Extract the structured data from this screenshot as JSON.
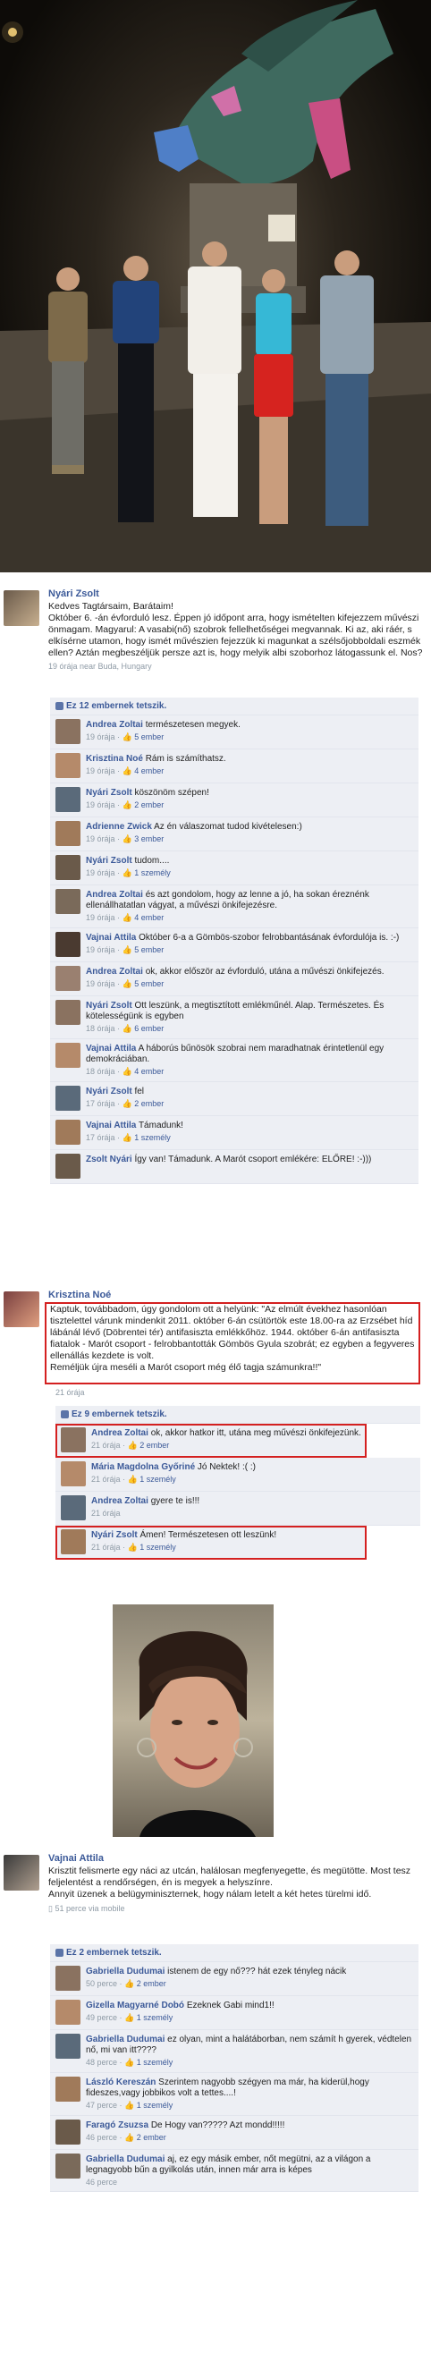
{
  "post1": {
    "author": "Nyári Zsolt",
    "text": "Kedves Tagtársaim, Barátaim!\nOktóber 6. -án évforduló lesz. Éppen jó időpont arra, hogy ismételten kifejezzem művészi önmagam. Magyarul: A vasabi(nő) szobrok fellelhetőségei megvannak. Ki az, aki ráér, s elkísérne utamon, hogy ismét művészien fejezzük ki magunkat a szélsőjobboldali eszmék ellen? Aztán megbeszéljük persze azt is, hogy melyik albi szoborhoz látogassunk el. Nos?",
    "meta": "19 órája near Buda, Hungary",
    "likes": "Ez 12 embernek tetszik.",
    "comments": [
      {
        "author": "Andrea Zoltai",
        "text": "természetesen megyek.",
        "time": "19 órája",
        "likes": "5 ember"
      },
      {
        "author": "Krisztina Noé",
        "text": "Rám is számíthatsz.",
        "time": "19 órája",
        "likes": "4 ember"
      },
      {
        "author": "Nyári Zsolt",
        "text": "köszönöm szépen!",
        "time": "19 órája",
        "likes": "2 ember"
      },
      {
        "author": "Adrienne Zwick",
        "text": "Az én válaszomat tudod kivételesen:)",
        "time": "19 órája",
        "likes": "3 ember"
      },
      {
        "author": "Nyári Zsolt",
        "text": "tudom....",
        "time": "19 órája",
        "likes": "1 személy"
      },
      {
        "author": "Andrea Zoltai",
        "text": "és azt gondolom, hogy az lenne a jó, ha sokan éreznénk ellenállhatatlan vágyat, a művészi önkifejezésre.",
        "time": "19 órája",
        "likes": "4 ember"
      },
      {
        "author": "Vajnai Attila",
        "text": "Október 6-a a Gömbös-szobor felrobbantásának évfordulója is. :-)",
        "time": "19 órája",
        "likes": "5 ember"
      },
      {
        "author": "Andrea Zoltai",
        "text": "ok, akkor először az évforduló, utána a művészi önkifejezés.",
        "time": "19 órája",
        "likes": "5 ember"
      },
      {
        "author": "Nyári Zsolt",
        "text": "Ott leszünk, a megtisztított emlékműnél. Alap. Természetes. És kötelességünk is egyben",
        "time": "18 órája",
        "likes": "6 ember"
      },
      {
        "author": "Vajnai Attila",
        "text": "A háborús bűnösök szobrai nem maradhatnak érintetlenül egy demokráciában.",
        "time": "18 órája",
        "likes": "4 ember"
      },
      {
        "author": "Nyári Zsolt",
        "text": "fel",
        "time": "17 órája",
        "likes": "2 ember"
      },
      {
        "author": "Vajnai Attila",
        "text": "Támadunk!",
        "time": "17 órája",
        "likes": "1 személy"
      },
      {
        "author": "Zsolt Nyári",
        "text": "Így van! Támadunk. A Marót csoport emlékére: ELŐRE! :-)))",
        "time": "",
        "likes": ""
      }
    ]
  },
  "post2": {
    "author": "Krisztina Noé",
    "text": "Kaptuk, továbbadom, úgy gondolom ott a helyünk: \"Az elmúlt évekhez hasonlóan tisztelettel várunk mindenkit 2011. október 6-án csütörtök este 18.00-ra az Erzsébet híd lábánál lévő (Döbrentei tér) antifasiszta emlékkőhöz. 1944. október 6-án antifasiszta fiatalok - Marót csoport - felrobbantották Gömbös Gyula szobrát; ez egyben a fegyveres ellenállás kezdete is volt.\nReméljük újra meséli a Marót csoport még élő tagja számunkra!!\"",
    "meta": "21 órája",
    "likes": "Ez 9 embernek tetszik.",
    "comments": [
      {
        "author": "Andrea Zoltai",
        "text": "ok, akkor hatkor itt, utána meg művészi önkifejezünk.",
        "time": "21 órája",
        "likes": "2 ember"
      },
      {
        "author": "Mária Magdolna Győriné",
        "text": "Jó Nektek! :( :)",
        "time": "21 órája",
        "likes": "1 személy"
      },
      {
        "author": "Andrea Zoltai",
        "text": "gyere te is!!!",
        "time": "21 órája",
        "likes": ""
      },
      {
        "author": "Nyári Zsolt",
        "text": "Ámen! Természetesen ott leszünk!",
        "time": "21 órája",
        "likes": "1 személy"
      }
    ]
  },
  "post3": {
    "author": "Vajnai Attila",
    "text": "Krisztit felismerte egy náci az utcán, halálosan megfenyegette, és megütötte. Most tesz feljelentést a rendőrségen, én is megyek a helyszínre.\nAnnyit üzenek a belügyminiszternek, hogy nálam letelt a két hetes türelmi idő.",
    "meta": "51 perce via mobile",
    "likes": "Ez 2 embernek tetszik.",
    "comments": [
      {
        "author": "Gabriella Dudumai",
        "text": "istenem de egy nő??? hát ezek tényleg nácik",
        "time": "50 perce",
        "likes": "2 ember"
      },
      {
        "author": "Gizella Magyarné Dobó",
        "text": "Ezeknek Gabi mind1!!",
        "time": "49 perce",
        "likes": "1 személy"
      },
      {
        "author": "Gabriella Dudumai",
        "text": "ez olyan, mint a halátáborban, nem számít h gyerek, védtelen nő, mi van itt????",
        "time": "48 perce",
        "likes": "1 személy"
      },
      {
        "author": "László Kereszán",
        "text": "Szerintem nagyobb szégyen ma már, ha kiderül,hogy fideszes,vagy jobbikos volt a tettes....!",
        "time": "47 perce",
        "likes": "1 személy"
      },
      {
        "author": "Faragó Zsuzsa",
        "text": "De Hogy van????? Azt mondd!!!!!",
        "time": "46 perce",
        "likes": "2 ember"
      },
      {
        "author": "Gabriella Dudumai",
        "text": "aj, ez egy másik ember, nőt megütni, az a világon a legnagyobb bűn a gyilkolás után, innen már arra is képes",
        "time": "46 perce",
        "likes": ""
      }
    ]
  }
}
